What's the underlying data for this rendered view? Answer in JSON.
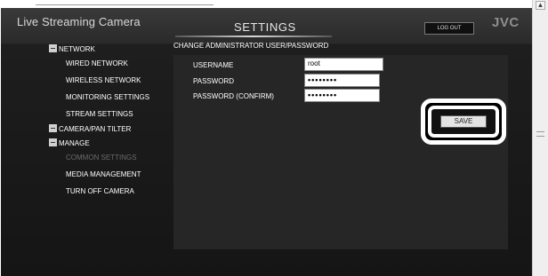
{
  "header": {
    "app_title": "Live Streaming Camera",
    "page_title": "SETTINGS",
    "logout_label": "LOG OUT",
    "logo_text": "JVC"
  },
  "sidebar": {
    "sections": [
      {
        "label": "NETWORK",
        "items": [
          {
            "label": "WIRED NETWORK",
            "enabled": true
          },
          {
            "label": "WIRELESS NETWORK",
            "enabled": true
          },
          {
            "label": "MONITORING SETTINGS",
            "enabled": true
          },
          {
            "label": "STREAM SETTINGS",
            "enabled": true
          }
        ]
      },
      {
        "label": "CAMERA/PAN TILTER",
        "items": []
      },
      {
        "label": "MANAGE",
        "items": [
          {
            "label": "COMMON SETTINGS",
            "enabled": false
          },
          {
            "label": "MEDIA MANAGEMENT",
            "enabled": true
          },
          {
            "label": "TURN OFF CAMERA",
            "enabled": true
          }
        ]
      }
    ]
  },
  "form": {
    "title": "CHANGE ADMINISTRATOR USER/PASSWORD",
    "username": {
      "label": "USERNAME",
      "value": "root"
    },
    "password": {
      "label": "PASSWORD",
      "value": "••••••••"
    },
    "password_confirm": {
      "label": "PASSWORD (CONFIRM)",
      "value": "••••••••"
    },
    "save_label": "SAVE"
  },
  "colors": {
    "background": "#151515",
    "panel": "#262626",
    "highlight_ring": "#ffffff",
    "disabled_text": "#6b6b6b"
  }
}
